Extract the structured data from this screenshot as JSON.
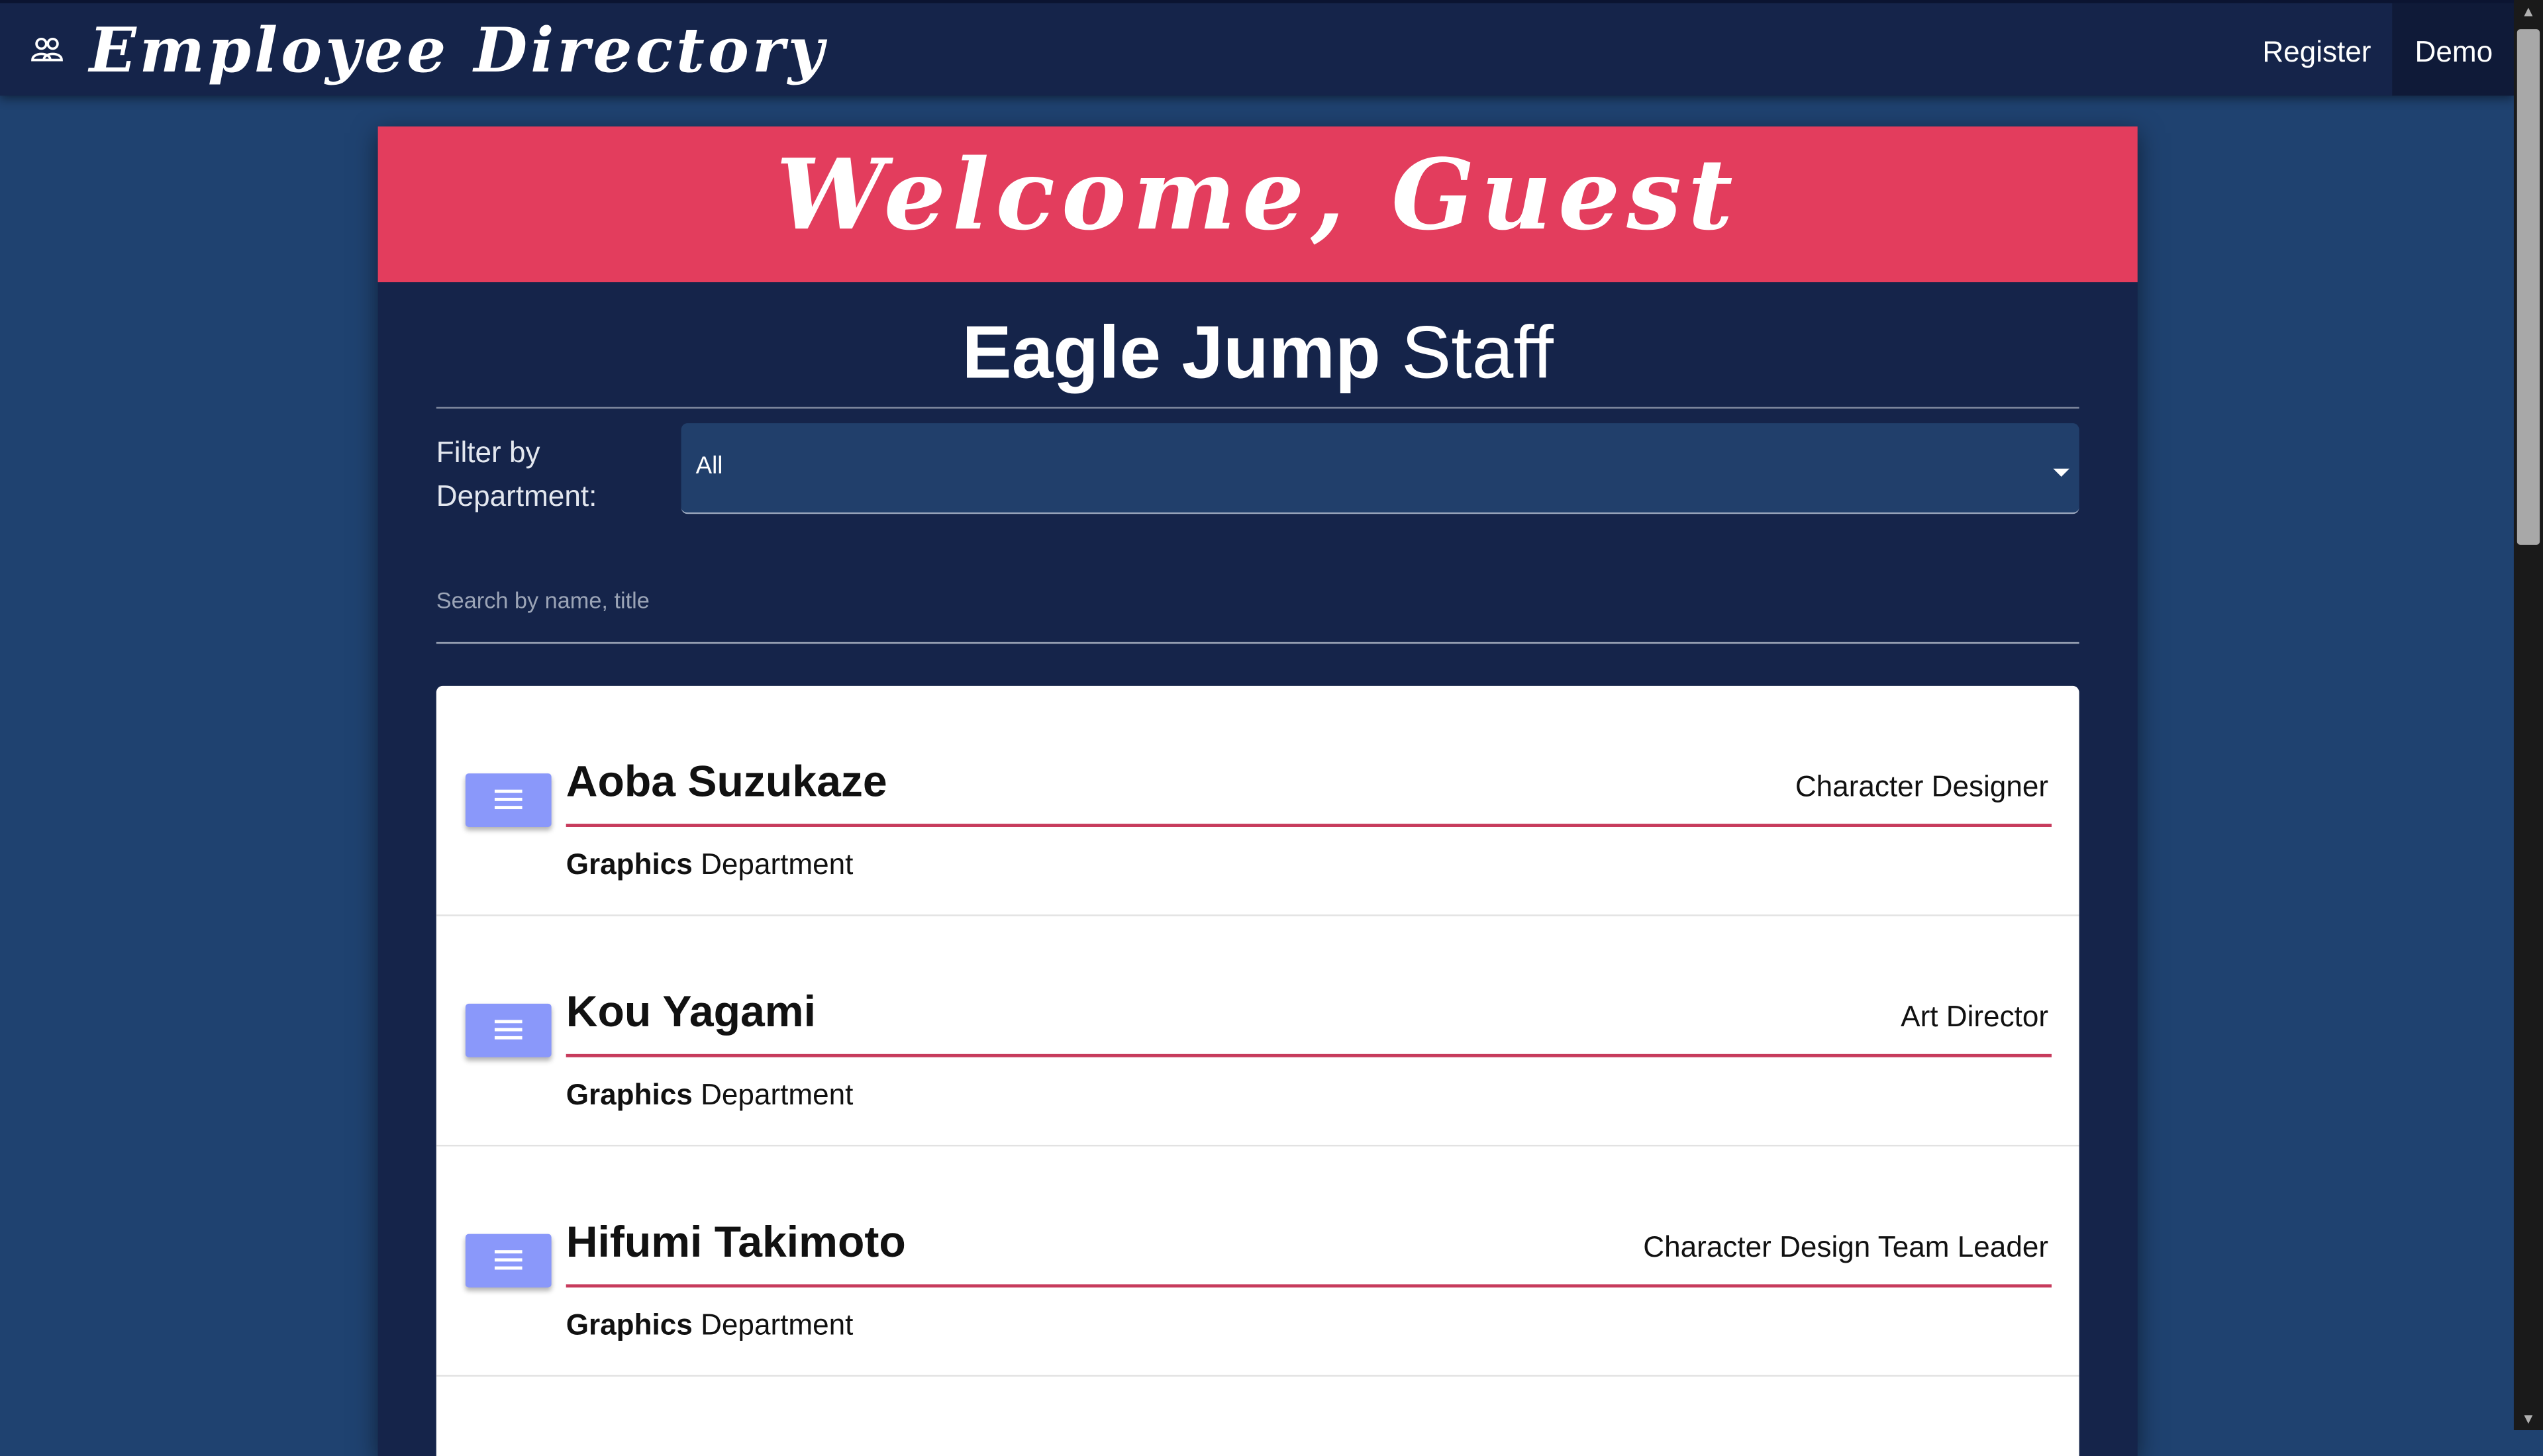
{
  "navbar": {
    "brand_icon": "people-icon",
    "title": "Employee Directory",
    "links": [
      {
        "label": "Register"
      },
      {
        "label": "Demo"
      }
    ]
  },
  "banner": {
    "text": "Welcome, Guest",
    "color": "#e33d5d"
  },
  "heading": {
    "bold_part": "Eagle Jump",
    "light_part": "Staff"
  },
  "filter": {
    "label": "Filter by Department:",
    "selected": "All"
  },
  "search": {
    "placeholder": "Search by name, title",
    "value": ""
  },
  "employees": [
    {
      "name": "Aoba Suzukaze",
      "title": "Character Designer",
      "department": "Graphics",
      "department_suffix": "Department"
    },
    {
      "name": "Kou Yagami",
      "title": "Art Director",
      "department": "Graphics",
      "department_suffix": "Department"
    },
    {
      "name": "Hifumi Takimoto",
      "title": "Character Design Team Leader",
      "department": "Graphics",
      "department_suffix": "Department"
    }
  ],
  "colors": {
    "background": "#1f4270",
    "panel": "#15244a",
    "accent": "#e33d5d",
    "menu_button": "#8a98fa"
  }
}
